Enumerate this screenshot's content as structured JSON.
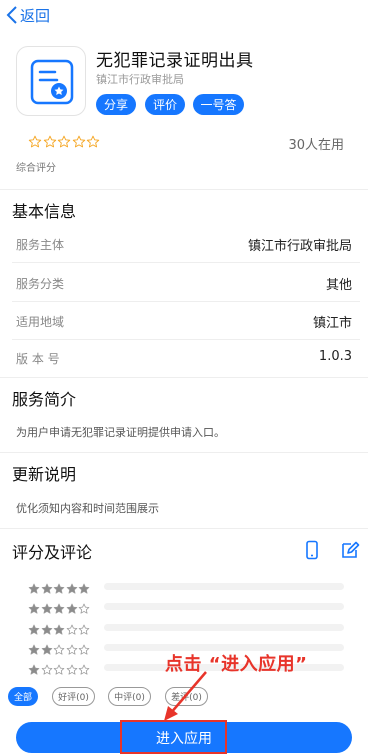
{
  "nav": {
    "back_label": "返回"
  },
  "app": {
    "title": "无犯罪记录证明出具",
    "org": "镇江市行政审批局",
    "buttons": [
      "分享",
      "评价",
      "一号答"
    ],
    "rating_stars": 0,
    "users": "30人在用",
    "score_label": "综合评分"
  },
  "basic_info": {
    "title": "基本信息",
    "rows": [
      {
        "label": "服务主体",
        "value": "镇江市行政审批局"
      },
      {
        "label": "服务分类",
        "value": "其他"
      },
      {
        "label": "适用地域",
        "value": "镇江市"
      },
      {
        "label": "版 本 号",
        "value": "1.0.3"
      }
    ]
  },
  "intro": {
    "title": "服务简介",
    "text": "为用户申请无犯罪记录证明提供申请入口。"
  },
  "update": {
    "title": "更新说明",
    "text": "优化须知内容和时间范围展示"
  },
  "reviews": {
    "title": "评分及评论",
    "distribution": [
      {
        "stars": 5,
        "fraction": 0
      },
      {
        "stars": 4,
        "fraction": 0
      },
      {
        "stars": 3,
        "fraction": 0
      },
      {
        "stars": 2,
        "fraction": 0
      },
      {
        "stars": 1,
        "fraction": 0
      }
    ],
    "filters": [
      "全部",
      "好评(0)",
      "中评(0)",
      "差评(0)"
    ],
    "active_filter": "全部"
  },
  "annotation": {
    "text": "点击 “进入应用”"
  },
  "enter_button": {
    "label": "进入应用"
  },
  "colors": {
    "accent": "#1677ff",
    "annotation": "#e8342a",
    "star": "#f5a623"
  }
}
